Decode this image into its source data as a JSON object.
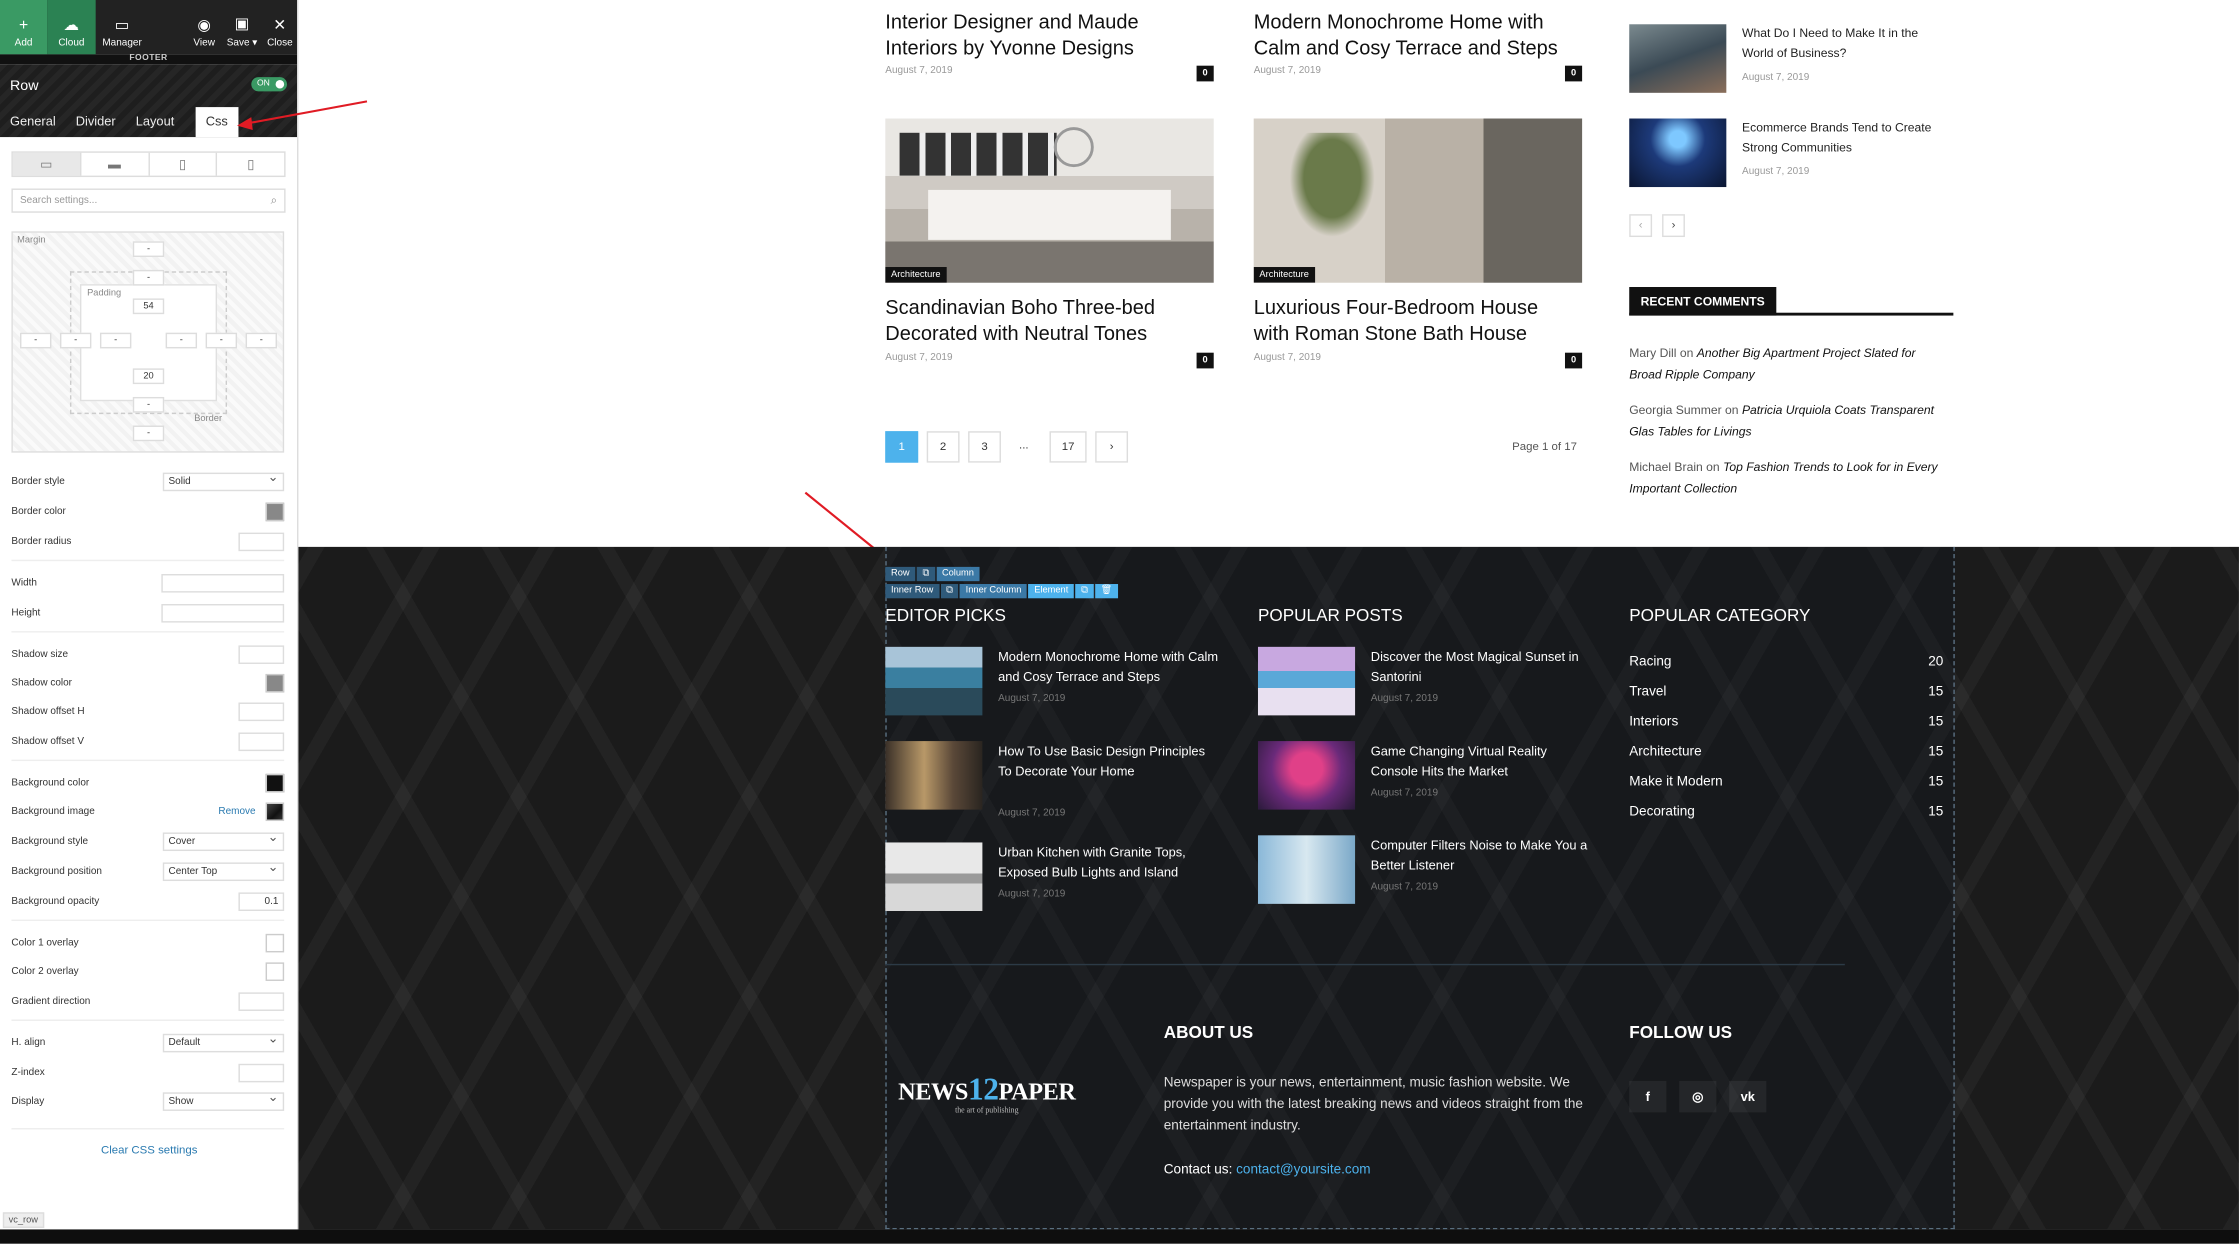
{
  "toolbar": {
    "add": "Add",
    "cloud": "Cloud",
    "manager": "Manager",
    "view": "View",
    "save": "Save ▾",
    "close": "Close",
    "section": "FOOTER"
  },
  "editor": {
    "element": "Row",
    "toggle": "ON",
    "tabs": [
      "General",
      "Divider",
      "Layout",
      "Css"
    ],
    "search_placeholder": "Search settings...",
    "box": {
      "margin_label": "Margin",
      "padding_label": "Padding",
      "border_label": "Border",
      "margin_top": "-",
      "border_top": "-",
      "padding_top": "54",
      "padding_bottom": "20",
      "border_bottom": "-",
      "margin_bottom": "-",
      "margin_left": "-",
      "border_left": "-",
      "padding_left": "-",
      "padding_right": "-",
      "border_right": "-",
      "margin_right": "-"
    },
    "props": {
      "border_style": {
        "label": "Border style",
        "value": "Solid"
      },
      "border_color": {
        "label": "Border color"
      },
      "border_radius": {
        "label": "Border radius"
      },
      "width": {
        "label": "Width"
      },
      "height": {
        "label": "Height"
      },
      "shadow_size": {
        "label": "Shadow size"
      },
      "shadow_color": {
        "label": "Shadow color"
      },
      "shadow_offset_h": {
        "label": "Shadow offset H"
      },
      "shadow_offset_v": {
        "label": "Shadow offset V"
      },
      "bg_color": {
        "label": "Background color"
      },
      "bg_image": {
        "label": "Background image",
        "action": "Remove"
      },
      "bg_style": {
        "label": "Background style",
        "value": "Cover"
      },
      "bg_position": {
        "label": "Background position",
        "value": "Center Top"
      },
      "bg_opacity": {
        "label": "Background opacity",
        "value": "0.1"
      },
      "color1": {
        "label": "Color 1 overlay"
      },
      "color2": {
        "label": "Color 2 overlay"
      },
      "gradient": {
        "label": "Gradient direction"
      },
      "h_align": {
        "label": "H. align",
        "value": "Default"
      },
      "z_index": {
        "label": "Z-index"
      },
      "display": {
        "label": "Display",
        "value": "Show"
      }
    },
    "clear": "Clear CSS settings",
    "status": "vc_row"
  },
  "posts": [
    {
      "title": "Interior Designer and Maude Interiors by Yvonne Designs",
      "date": "August 7, 2019",
      "comments": "0"
    },
    {
      "title": "Modern Monochrome Home with Calm and Cosy Terrace and Steps",
      "date": "August 7, 2019",
      "comments": "0"
    },
    {
      "title": "Scandinavian Boho Three-bed Decorated with Neutral Tones",
      "date": "August 7, 2019",
      "comments": "0",
      "category": "Architecture"
    },
    {
      "title": "Luxurious Four-Bedroom House with Roman Stone Bath House",
      "date": "August 7, 2019",
      "comments": "0",
      "category": "Architecture"
    }
  ],
  "pagination": {
    "pages": [
      "1",
      "2",
      "3",
      "...",
      "17"
    ],
    "next": "›",
    "info": "Page 1 of 17"
  },
  "sidebar": {
    "posts": [
      {
        "title": "What Do I Need to Make It in the World of Business?",
        "date": "August 7, 2019"
      },
      {
        "title": "Ecommerce Brands Tend to Create Strong Communities",
        "date": "August 7, 2019"
      }
    ],
    "prev": "‹",
    "next": "›",
    "recent_comments_title": "RECENT COMMENTS",
    "comments": [
      {
        "author": "Mary Dill",
        "on": "on",
        "post": "Another Big Apartment Project Slated for Broad Ripple Company"
      },
      {
        "author": "Georgia Summer",
        "on": "on",
        "post": "Patricia Urquiola Coats Transparent Glas Tables for Livings"
      },
      {
        "author": "Michael Brain",
        "on": "on",
        "post": "Top Fashion Trends to Look for in Every Important Collection"
      }
    ]
  },
  "breadcrumbs": {
    "row1": [
      "Row",
      "⧉",
      "Column"
    ],
    "row2": [
      "Inner Row",
      "⧉",
      "Inner Column",
      "Element",
      "⧉",
      "🗑"
    ]
  },
  "footer": {
    "editor_picks": {
      "title": "EDITOR PICKS",
      "items": [
        {
          "title": "Modern Monochrome Home with Calm and Cosy Terrace and Steps",
          "date": "August 7, 2019"
        },
        {
          "title": "How To Use Basic Design Principles To Decorate Your Home",
          "date": "August 7, 2019"
        },
        {
          "title": "Urban Kitchen with Granite Tops, Exposed Bulb Lights and Island",
          "date": "August 7, 2019"
        }
      ]
    },
    "popular_posts": {
      "title": "POPULAR POSTS",
      "items": [
        {
          "title": "Discover the Most Magical Sunset in Santorini",
          "date": "August 7, 2019"
        },
        {
          "title": "Game Changing Virtual Reality Console Hits the Market",
          "date": "August 7, 2019"
        },
        {
          "title": "Computer Filters Noise to Make You a Better Listener",
          "date": "August 7, 2019"
        }
      ]
    },
    "popular_category": {
      "title": "POPULAR CATEGORY",
      "items": [
        {
          "name": "Racing",
          "count": "20"
        },
        {
          "name": "Travel",
          "count": "15"
        },
        {
          "name": "Interiors",
          "count": "15"
        },
        {
          "name": "Architecture",
          "count": "15"
        },
        {
          "name": "Make it Modern",
          "count": "15"
        },
        {
          "name": "Decorating",
          "count": "15"
        }
      ]
    },
    "logo": {
      "part1": "NEWS",
      "part2": "12",
      "part3": "PAPER",
      "tagline": "the art of publishing"
    },
    "about": {
      "title": "ABOUT US",
      "text": "Newspaper is your news, entertainment, music fashion website. We provide you with the latest breaking news and videos straight from the entertainment industry.",
      "contact_label": "Contact us:",
      "contact_email": "contact@yoursite.com"
    },
    "follow": {
      "title": "FOLLOW US",
      "icons": [
        "f",
        "◎",
        "vk"
      ]
    }
  },
  "colors": {
    "accent": "#4db2ec",
    "panel_green": "#3a9a64",
    "arrow": "#e01b24",
    "footer_bg": "#1b1b1b"
  }
}
